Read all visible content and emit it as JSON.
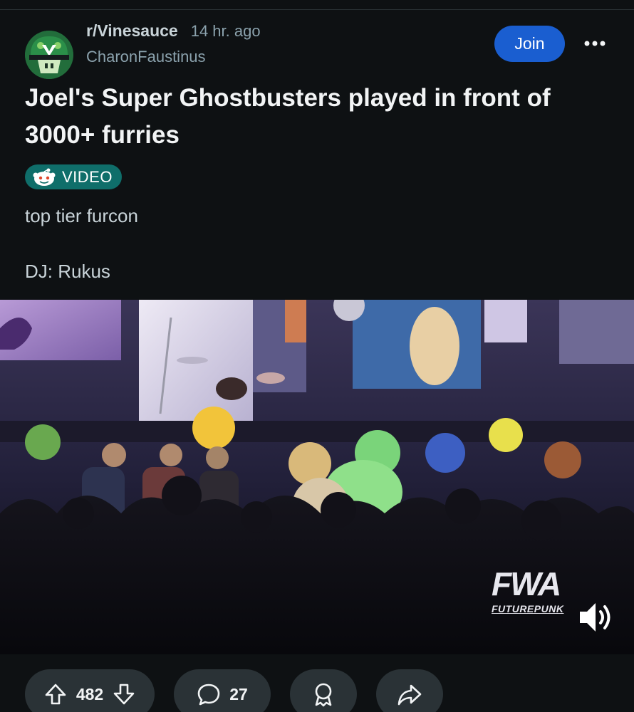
{
  "post": {
    "subreddit": "r/Vinesauce",
    "time": "14 hr. ago",
    "author": "CharonFaustinus",
    "join_label": "Join",
    "title": "Joel's Super Ghostbusters played in front of 3000+ furries",
    "flair": "VIDEO",
    "body": [
      "top tier furcon",
      "DJ: Rukus"
    ]
  },
  "video": {
    "watermark_logo": "FWA",
    "watermark_sub": "FUTUREPUNK"
  },
  "actions": {
    "score": "482",
    "comments": "27"
  },
  "colors": {
    "background": "#0e1113",
    "join": "#1a5ed0",
    "flair": "#0f6e6a",
    "pill": "#2a3236"
  }
}
